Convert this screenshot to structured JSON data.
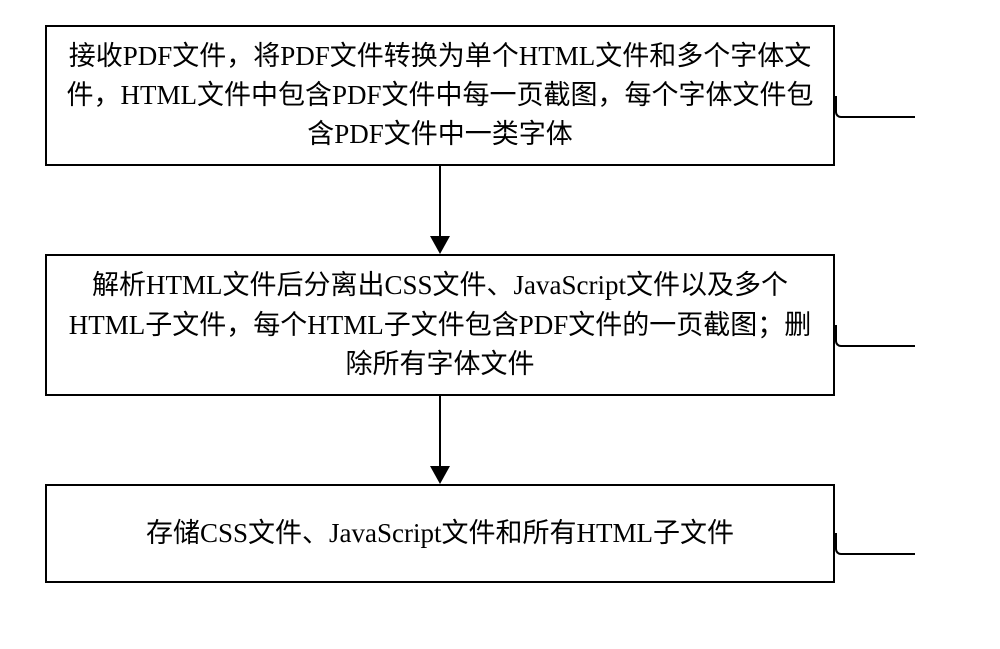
{
  "chart_data": {
    "type": "flowchart",
    "steps": [
      {
        "id": "S1",
        "text": "接收PDF文件，将PDF文件转换为单个HTML文件和多个字体文件，HTML文件中包含PDF文件中每一页截图，每个字体文件包含PDF文件中一类字体"
      },
      {
        "id": "S2",
        "text": "解析HTML文件后分离出CSS文件、JavaScript文件以及多个HTML子文件，每个HTML子文件包含PDF文件的一页截图；删除所有字体文件"
      },
      {
        "id": "S3",
        "text": "存储CSS文件、JavaScript文件和所有HTML子文件"
      }
    ],
    "connections": [
      {
        "from": "S1",
        "to": "S2"
      },
      {
        "from": "S2",
        "to": "S3"
      }
    ]
  }
}
